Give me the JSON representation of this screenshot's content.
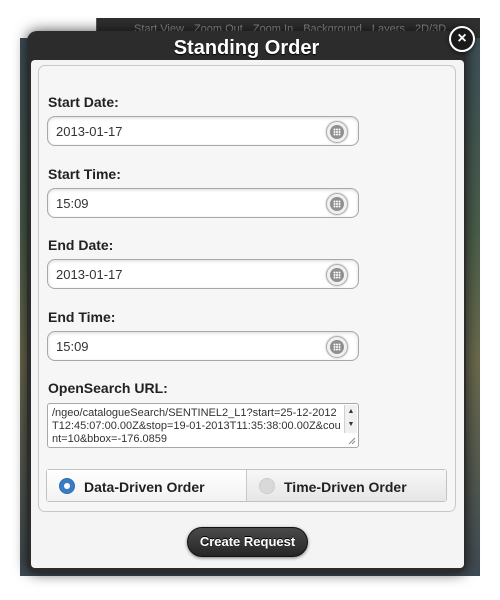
{
  "toolbar": {
    "items": [
      "Start View",
      "Zoom Out",
      "Zoom In",
      "Background",
      "Layers",
      "2D/3D"
    ]
  },
  "dialog": {
    "title": "Standing Order",
    "close_label": "×"
  },
  "fields": {
    "start_date": {
      "label": "Start Date:",
      "value": "2013-01-17"
    },
    "start_time": {
      "label": "Start Time:",
      "value": "15:09"
    },
    "end_date": {
      "label": "End Date:",
      "value": "2013-01-17"
    },
    "end_time": {
      "label": "End Time:",
      "value": "15:09"
    }
  },
  "opensearch": {
    "label": "OpenSearch URL:",
    "value": "/ngeo/catalogueSearch/SENTINEL2_L1?start=25-12-2012T12:45:07:00.00Z&stop=19-01-2013T11:35:38:00.00Z&count=10&bbox=-176.0859"
  },
  "order_type": {
    "options": [
      {
        "label": "Data-Driven Order",
        "selected": true
      },
      {
        "label": "Time-Driven Order",
        "selected": false
      }
    ]
  },
  "actions": {
    "create_label": "Create Request"
  },
  "colors": {
    "accent": "#3a7bc6",
    "dialog_frame": "#2c2c2c",
    "button": "#262626"
  },
  "icons": {
    "picker": "grid-dots-icon",
    "close": "close-icon",
    "radio": "radio-icon"
  }
}
